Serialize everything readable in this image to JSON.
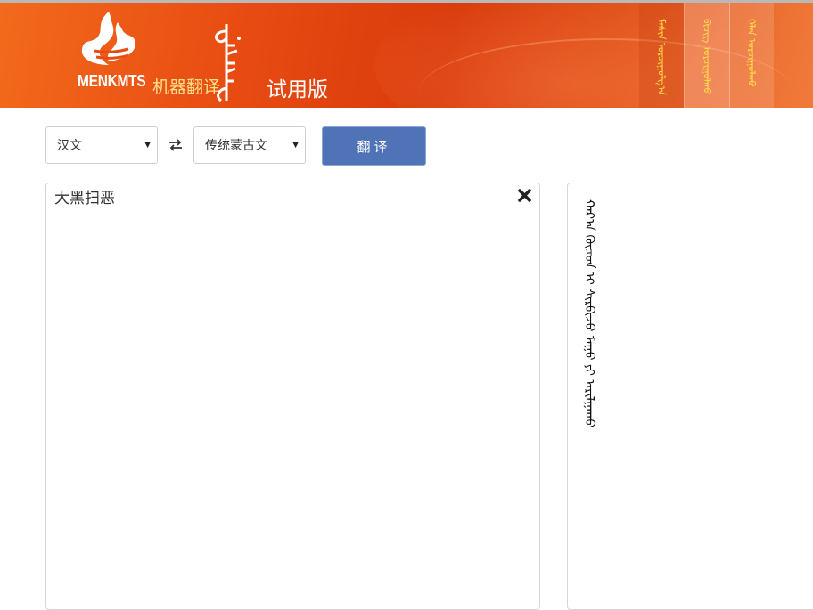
{
  "header": {
    "logo_text": "MENKMTS",
    "brand_cn": "机器翻译",
    "trial_label": "试用版",
    "tabs": [
      {
        "label": "ᠮᠠᠰᠢᠨ ᠣᠷᠴᠢᠭᠤᠯᠭ᠎ᠠ"
      },
      {
        "label": "ᠪᠢᠴᠢᠭ ᠣᠷᠴᠢᠭᠤᠯᠬᠤ"
      },
      {
        "label": "ᠬᠡᠯᠡᠨ ᠣᠷᠴᠢᠭᠤᠯᠬᠤ"
      }
    ]
  },
  "toolbar": {
    "source_lang": "汉文",
    "target_lang": "传统蒙古文",
    "translate_label": "翻译"
  },
  "source": {
    "text": "大黑扫恶"
  },
  "output": {
    "text": "ᠬᠠᠷ᠎ᠠ ᠬᠦᠴᠦᠨ ᠢ ᠰᠢᠷᠪᠢᠵᠦ ᠮᠠᠭᠤ ᠶᠢ ᠠᠷᠢᠯᠭᠠᠬᠤ"
  },
  "colors": {
    "header_orange": "#e84b12",
    "brand_yellow": "#ffe08a",
    "tab_yellow": "#ffe14a",
    "button_blue": "#4f73b6"
  }
}
